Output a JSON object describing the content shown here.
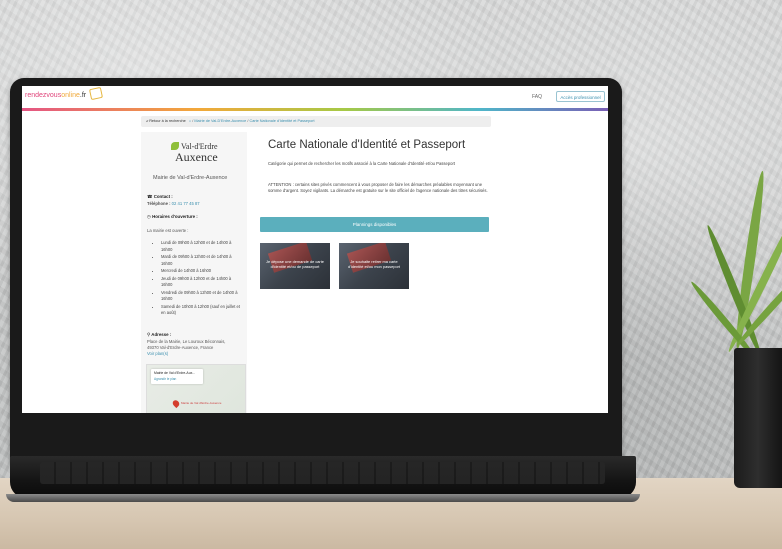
{
  "header": {
    "logo_part1": "rendezvous",
    "logo_part2": "online",
    "logo_part3": ".fr",
    "faq": "FAQ",
    "pro_button": "Accès professionnel"
  },
  "breadcrumb": {
    "back": "Retour à la recherche",
    "crumb1": "Mairie de Val-D'Erdre-Auxence",
    "crumb2": "Carte Nationale d'Identité et Passeport"
  },
  "sidebar": {
    "logo_line1": "Val-d'Erdre",
    "logo_line2": "Auxence",
    "name": "Mairie de Val-d'Erdre-Auxence",
    "contact_label": "Contact :",
    "phone_label": "Téléphone :",
    "phone": "02 41 77 45 87",
    "hours_label": "Horaires d'ouverture :",
    "hours_intro": "La mairie est ouverte :",
    "hours": [
      "Lundi de 09h00 à 12h00 et de 14h00 à 16h00",
      "Mardi de 09h00 à 12h00 et de 14h00 à 16h00",
      "Mercredi de 14h00 à 16h00",
      "Jeudi de 09h00 à 12h00 et de 14h00 à 16h00",
      "Vendredi de 09h00 à 12h00 et de 14h00 à 16h00",
      "Samedi de 10h00 à 12h00 (sauf en juillet et en août)"
    ],
    "address_label": "Adresse :",
    "address_line1": "Place de la Mairie, Le Louroux Béconnais,",
    "address_line2": "49370 Val-d'Erdre-Auxence, France",
    "map_link": "Voir plan(s)",
    "map_place": "Mairie de Val d'Erdre-Aux...",
    "map_larger": "Agrandir le plan",
    "map_pin_label": "Mairie de Val d'Erdre-Auxence"
  },
  "main": {
    "title": "Carte Nationale d'Identité et Passeport",
    "desc1": "Catégorie qui permet de rechercher les motifs associé à la Carte Nationale d'Identité et/ou Passeport",
    "desc2": "ATTENTION : certains sites privés commencent à vous proposer de faire les démarches préalables moyennant une somme d'argent. Soyez vigilants. La démarche est gratuite sur le site officiel de l'agence nationale des titres sécurisés.",
    "planning_button": "Plannings disponibles",
    "tile1": "Je dépose une demande de carte d'identité et/ou de passeport",
    "tile2": "Je souhaite retirer ma carte d'identité et/ou mon passeport"
  },
  "colors": {
    "accent": "#5bafbd",
    "link": "#3a8fae"
  }
}
